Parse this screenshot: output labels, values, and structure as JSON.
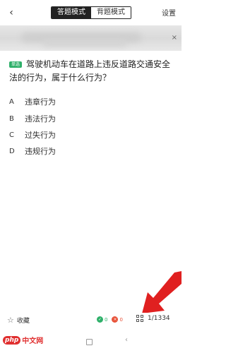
{
  "header": {
    "back_label": "‹",
    "tabs": [
      {
        "label": "答题模式",
        "active": true
      },
      {
        "label": "背题模式",
        "active": false
      }
    ],
    "settings_label": "设置"
  },
  "banner": {
    "close_label": "×"
  },
  "question": {
    "type_badge": "单选",
    "text": "驾驶机动车在道路上违反道路交通安全法的行为，属于什么行为？"
  },
  "options": [
    {
      "letter": "A",
      "text": "违章行为"
    },
    {
      "letter": "B",
      "text": "违法行为"
    },
    {
      "letter": "C",
      "text": "过失行为"
    },
    {
      "letter": "D",
      "text": "违规行为"
    }
  ],
  "bottom": {
    "favorite_label": "收藏",
    "correct_count": "0",
    "wrong_count": "0",
    "progress": "1/1334"
  },
  "watermark": {
    "brand": "php",
    "site": "中文网"
  },
  "colors": {
    "accent_green": "#2fb06a",
    "wrong_red": "#e8533a",
    "pointer_red": "#e02020"
  }
}
